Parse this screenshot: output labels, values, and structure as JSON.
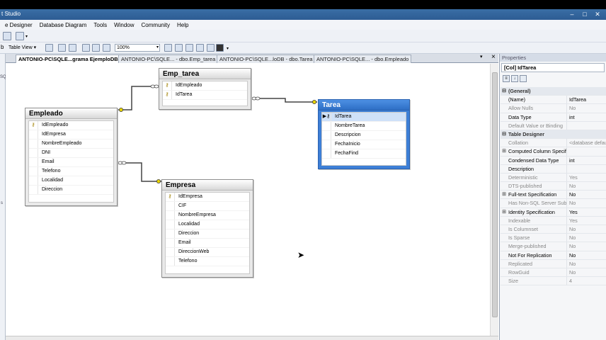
{
  "window": {
    "title": "t Studio"
  },
  "menu": [
    "e Designer",
    "Database Diagram",
    "Tools",
    "Window",
    "Community",
    "Help"
  ],
  "toolbar": {
    "table_view_label": "Table View",
    "zoom_value": "100%"
  },
  "tabs": [
    {
      "label": "ANTONIO-PC\\SQLE...grama EjemploDB",
      "active": true
    },
    {
      "label": "ANTONIO-PC\\SQLE... - dbo.Emp_tarea",
      "active": false
    },
    {
      "label": "ANTONIO-PC\\SQLE...loDB - dbo.Tarea",
      "active": false
    },
    {
      "label": "ANTONIO-PC\\SQLE... - dbo.Empleado",
      "active": false
    }
  ],
  "tables": {
    "empleado": {
      "title": "Empleado",
      "columns": [
        "IdEmpleado",
        "IdEmpresa",
        "NombreEmpleado",
        "DNI",
        "Email",
        "Telefono",
        "Localidad",
        "Direccion"
      ]
    },
    "emp_tarea": {
      "title": "Emp_tarea",
      "columns": [
        "IdEmpleado",
        "IdTarea"
      ]
    },
    "tarea": {
      "title": "Tarea",
      "columns": [
        "IdTarea",
        "NombreTarea",
        "Descripcion",
        "FechaInicio",
        "FechaFind"
      ]
    },
    "empresa": {
      "title": "Empresa",
      "columns": [
        "IdEmpresa",
        "CIF",
        "NombreEmpresa",
        "Localidad",
        "Direccion",
        "Email",
        "DireccionWeb",
        "Telefono"
      ]
    }
  },
  "left_strip": {
    "text1": "SQ",
    "text2": "s"
  },
  "properties": {
    "title": "Properties",
    "object": "[Col] IdTarea",
    "rows": [
      {
        "type": "cat",
        "name": "(General)"
      },
      {
        "name": "(Name)",
        "value": "IdTarea"
      },
      {
        "name": "Allow Nulls",
        "value": "No",
        "ro": true
      },
      {
        "name": "Data Type",
        "value": "int"
      },
      {
        "name": "Default Value or Binding",
        "value": "",
        "ro": true
      },
      {
        "type": "cat",
        "name": "Table Designer"
      },
      {
        "name": "Collation",
        "value": "<database default>",
        "ro": true
      },
      {
        "name": "Computed Column Specification",
        "value": "",
        "exp": true
      },
      {
        "name": "Condensed Data Type",
        "value": "int"
      },
      {
        "name": "Description",
        "value": ""
      },
      {
        "name": "Deterministic",
        "value": "Yes",
        "ro": true
      },
      {
        "name": "DTS-published",
        "value": "No",
        "ro": true
      },
      {
        "name": "Full-text Specification",
        "value": "No",
        "exp": true
      },
      {
        "name": "Has Non-SQL Server Subscriber",
        "value": "No",
        "ro": true
      },
      {
        "name": "Identity Specification",
        "value": "Yes",
        "exp": true
      },
      {
        "name": "Indexable",
        "value": "Yes",
        "ro": true
      },
      {
        "name": "Is Columnset",
        "value": "No",
        "ro": true
      },
      {
        "name": "Is Sparse",
        "value": "No",
        "ro": true
      },
      {
        "name": "Merge-published",
        "value": "No",
        "ro": true
      },
      {
        "name": "Not For Replication",
        "value": "No"
      },
      {
        "name": "Replicated",
        "value": "No",
        "ro": true
      },
      {
        "name": "RowGuid",
        "value": "No",
        "ro": true
      },
      {
        "name": "Size",
        "value": "4",
        "ro": true
      }
    ]
  }
}
